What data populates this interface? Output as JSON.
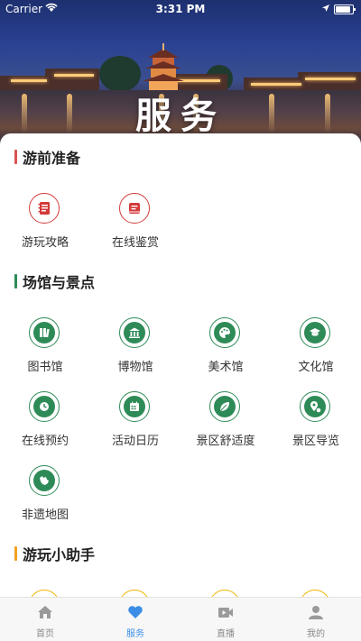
{
  "status_bar": {
    "carrier": "Carrier",
    "time": "3:31 PM"
  },
  "header": {
    "title": "服务"
  },
  "sections": [
    {
      "title": "游前准备",
      "accent": "#d9534f",
      "items": [
        {
          "label": "游玩攻略",
          "icon": "notebook-icon"
        },
        {
          "label": "在线鉴赏",
          "icon": "document-icon"
        }
      ]
    },
    {
      "title": "场馆与景点",
      "accent": "#2e8b57",
      "items": [
        {
          "label": "图书馆",
          "icon": "books-icon"
        },
        {
          "label": "博物馆",
          "icon": "museum-icon"
        },
        {
          "label": "美术馆",
          "icon": "palette-icon"
        },
        {
          "label": "文化馆",
          "icon": "graduation-cap-icon"
        },
        {
          "label": "在线预约",
          "icon": "clock-icon"
        },
        {
          "label": "活动日历",
          "icon": "calendar-icon"
        },
        {
          "label": "景区舒适度",
          "icon": "leaf-icon"
        },
        {
          "label": "景区导览",
          "icon": "map-pin-icon"
        },
        {
          "label": "非遗地图",
          "icon": "region-map-icon"
        }
      ]
    },
    {
      "title": "游玩小助手",
      "accent": "#f0a020",
      "items": []
    }
  ],
  "tabbar": [
    {
      "label": "首页",
      "icon": "home-icon",
      "active": false
    },
    {
      "label": "服务",
      "icon": "heart-icon",
      "active": true
    },
    {
      "label": "直播",
      "icon": "video-icon",
      "active": false
    },
    {
      "label": "我的",
      "icon": "user-icon",
      "active": false
    }
  ],
  "colors": {
    "red_accent": "#d33a3a",
    "green_accent": "#2e8b57",
    "yellow_accent": "#f0b400",
    "tab_active": "#3a8ee6"
  }
}
